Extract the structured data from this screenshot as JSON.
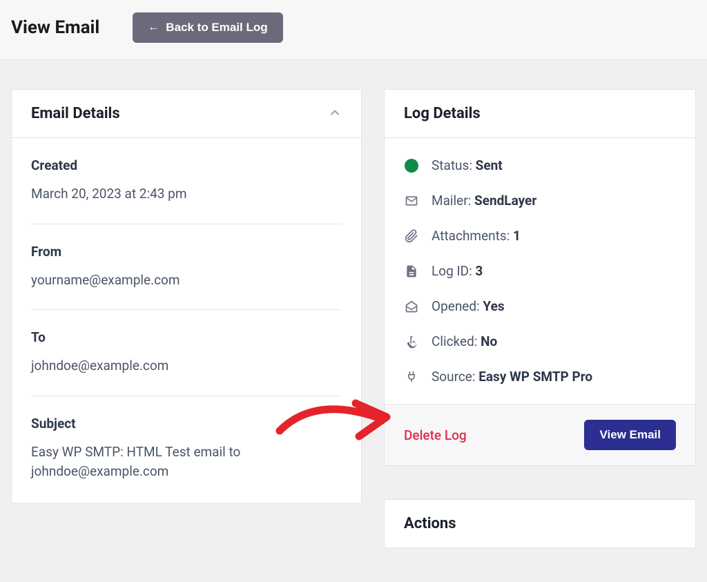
{
  "header": {
    "title": "View Email",
    "back_button": "Back to Email Log"
  },
  "email_details": {
    "title": "Email Details",
    "created": {
      "label": "Created",
      "value": "March 20, 2023 at 2:43 pm"
    },
    "from": {
      "label": "From",
      "value": "yourname@example.com"
    },
    "to": {
      "label": "To",
      "value": "johndoe@example.com"
    },
    "subject": {
      "label": "Subject",
      "value": "Easy WP SMTP: HTML Test email to johndoe@example.com"
    }
  },
  "log_details": {
    "title": "Log Details",
    "status": {
      "label": "Status:",
      "value": "Sent"
    },
    "mailer": {
      "label": "Mailer:",
      "value": "SendLayer"
    },
    "attachments": {
      "label": "Attachments:",
      "value": "1"
    },
    "log_id": {
      "label": "Log ID:",
      "value": "3"
    },
    "opened": {
      "label": "Opened:",
      "value": "Yes"
    },
    "clicked": {
      "label": "Clicked:",
      "value": "No"
    },
    "source": {
      "label": "Source:",
      "value": "Easy WP SMTP Pro"
    },
    "delete": "Delete Log",
    "view": "View Email"
  },
  "actions": {
    "title": "Actions"
  }
}
